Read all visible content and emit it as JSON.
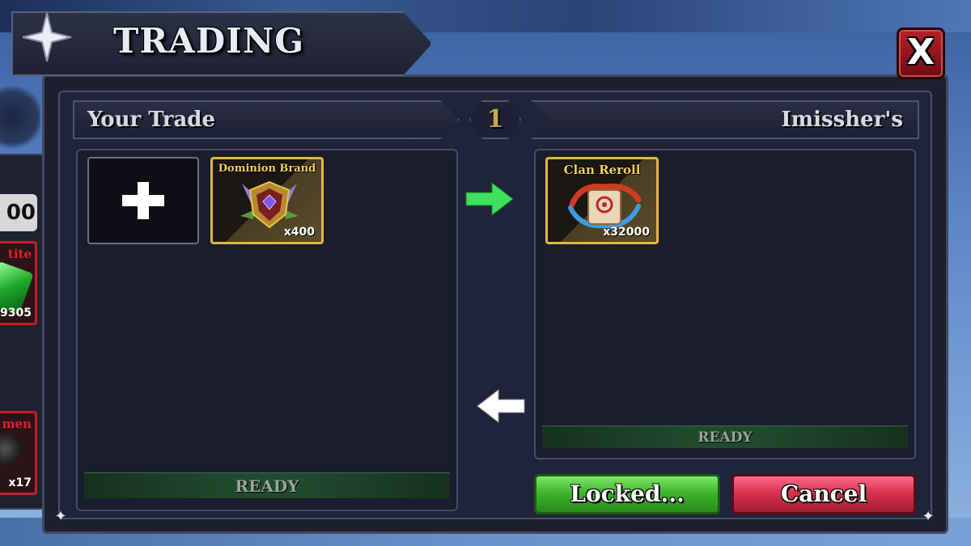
{
  "title": "TRADING",
  "close_label": "X",
  "round_number": "1",
  "your_side": {
    "header": "Your Trade",
    "items": [
      {
        "name": "Dominion Brand",
        "quantity": "x400"
      }
    ],
    "status": "READY"
  },
  "their_side": {
    "header": "Imissher's",
    "items": [
      {
        "name": "Clan Reroll",
        "quantity": "x32000"
      }
    ],
    "status": "READY"
  },
  "buttons": {
    "locked": "Locked...",
    "cancel": "Cancel"
  },
  "inventory_strip": {
    "amount_fragment": "00",
    "items": [
      {
        "name_fragment": "tite",
        "quantity_fragment": "9305"
      },
      {
        "name_fragment": "men",
        "quantity_fragment": "x17"
      }
    ]
  },
  "colors": {
    "accent_gold": "#e2b640",
    "ready_green": "#1f4a2e",
    "locked_green": "#3eb52c",
    "cancel_red": "#d8334f",
    "close_red": "#b8202a",
    "arrow_green": "#3fe05a"
  }
}
